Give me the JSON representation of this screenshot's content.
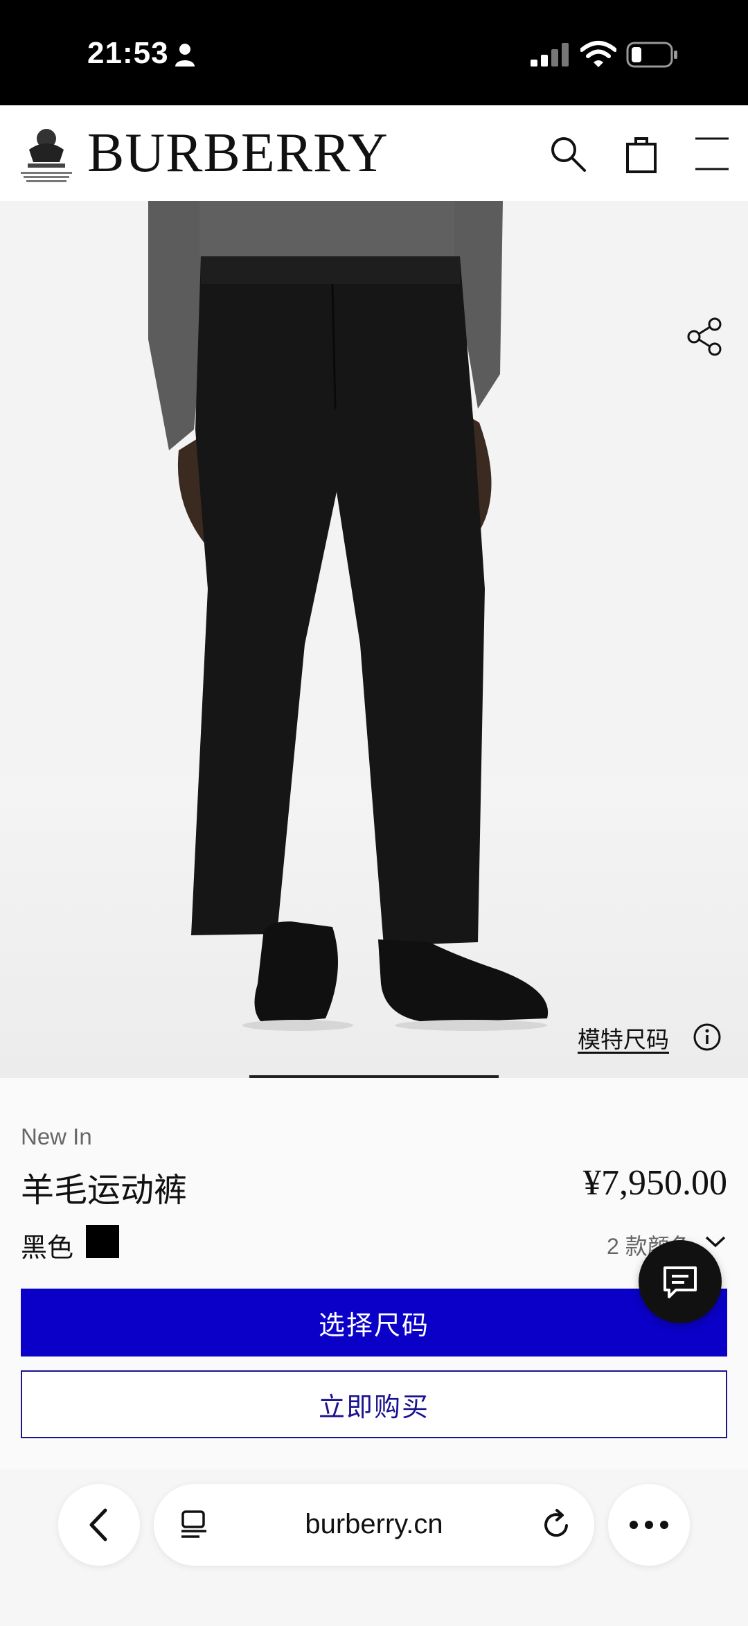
{
  "status_bar": {
    "time": "21:53",
    "icons": [
      "person-icon",
      "cellular-signal-icon",
      "wifi-icon",
      "battery-icon"
    ]
  },
  "header": {
    "brand": "BURBERRY",
    "crest_text": "BY APPOINTMENT TO HIS MAJESTY KING CHARLES III OUTFITTERS BURBERRY LIMITED LONDON",
    "icons": [
      "search-icon",
      "shopping-bag-icon",
      "hamburger-menu-icon"
    ]
  },
  "hero": {
    "model_size_label": "模特尺码",
    "icons": [
      "share-icon",
      "info-icon"
    ]
  },
  "product": {
    "badge": "New In",
    "title": "羊毛运动裤",
    "price": "¥7,950.00",
    "color_name": "黑色",
    "color_swatch": "#000000",
    "color_count": "2 款颜色"
  },
  "actions": {
    "select_size": "选择尺码",
    "buy_now": "立即购买"
  },
  "browser": {
    "url": "burberry.cn",
    "icons": [
      "back-arrow-icon",
      "tabs-icon",
      "reload-icon",
      "more-icon"
    ]
  },
  "colors": {
    "primary_button": "#0a00c8",
    "secondary_border": "#1a128f",
    "status_bar": "#000000"
  }
}
